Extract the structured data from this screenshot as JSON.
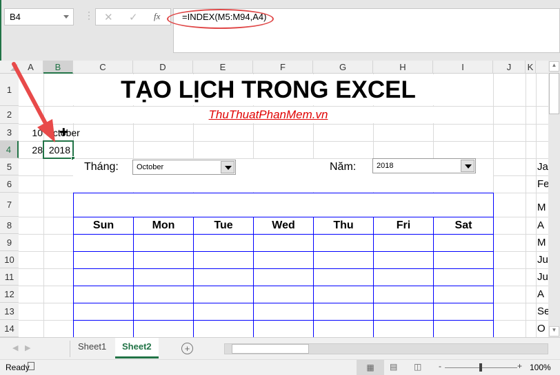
{
  "formula_bar": {
    "name_box": "B4",
    "cancel_icon": "✕",
    "enter_icon": "✓",
    "fx_label": "fx",
    "formula": "=INDEX(M5:M94,A4)"
  },
  "columns": [
    "A",
    "B",
    "C",
    "D",
    "E",
    "F",
    "G",
    "H",
    "I",
    "J",
    "K"
  ],
  "rows": [
    "1",
    "2",
    "3",
    "4",
    "5",
    "6",
    "7",
    "8",
    "9",
    "10",
    "11",
    "12",
    "13",
    "14"
  ],
  "sheet": {
    "title": "TẠO LỊCH TRONG EXCEL",
    "subtitle": "ThuThuatPhanMem.vn",
    "a3": "10",
    "b3": "October",
    "a4": "28",
    "b4": "2018",
    "month_label": "Tháng:",
    "month_value": "October",
    "year_label": "Năm:",
    "year_value": "2018",
    "weekdays": [
      "Sun",
      "Mon",
      "Tue",
      "Wed",
      "Thu",
      "Fri",
      "Sat"
    ],
    "month_list": [
      "Ja",
      "Fe",
      "M",
      "A",
      "M",
      "Ju",
      "Ju",
      "A",
      "Se",
      "O"
    ]
  },
  "sheet_tabs": [
    "Sheet1",
    "Sheet2"
  ],
  "active_tab": "Sheet2",
  "status": {
    "ready": "Ready",
    "zoom": "100%"
  },
  "colors": {
    "excel_green": "#217346",
    "calendar_border": "#0000ff",
    "subtitle": "#e00000",
    "annotation": "#e84a4a"
  }
}
